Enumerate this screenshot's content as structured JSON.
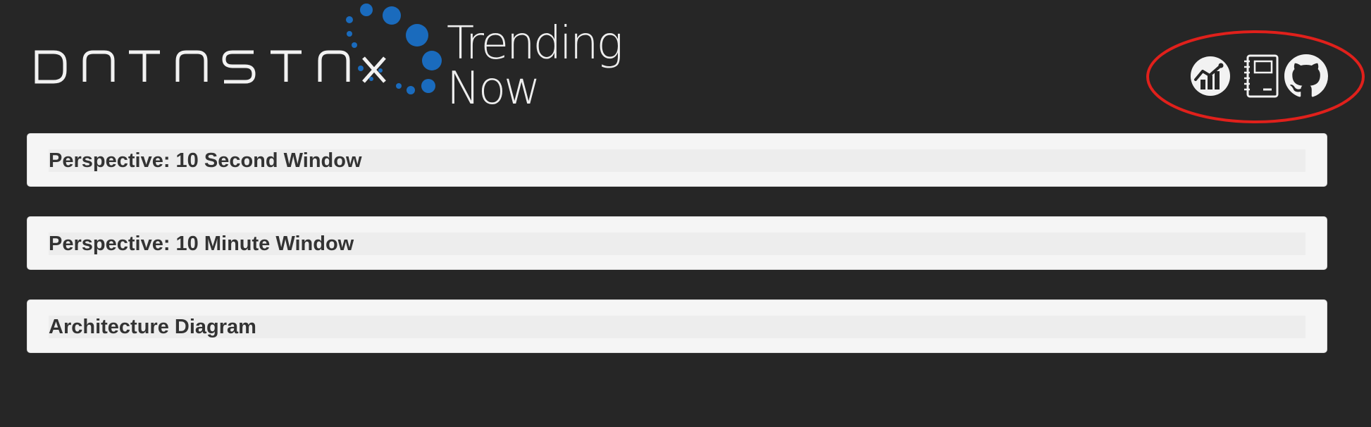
{
  "header": {
    "logo_text": "DATASTAX",
    "app_title": "Trending Now"
  },
  "toolbar": {
    "items": [
      {
        "icon": "analytics-chart-icon",
        "label": "Analytics"
      },
      {
        "icon": "notebook-icon",
        "label": "Notebook"
      },
      {
        "icon": "github-icon",
        "label": "GitHub"
      }
    ],
    "highlight_color": "#e0201b"
  },
  "panels": [
    {
      "title": "Perspective: 10 Second Window"
    },
    {
      "title": "Perspective: 10 Minute Window"
    },
    {
      "title": "Architecture Diagram"
    }
  ],
  "colors": {
    "background": "#262626",
    "logo_dots": "#1a6bbd",
    "panel_background": "#f5f5f5",
    "panel_text": "#333333"
  }
}
